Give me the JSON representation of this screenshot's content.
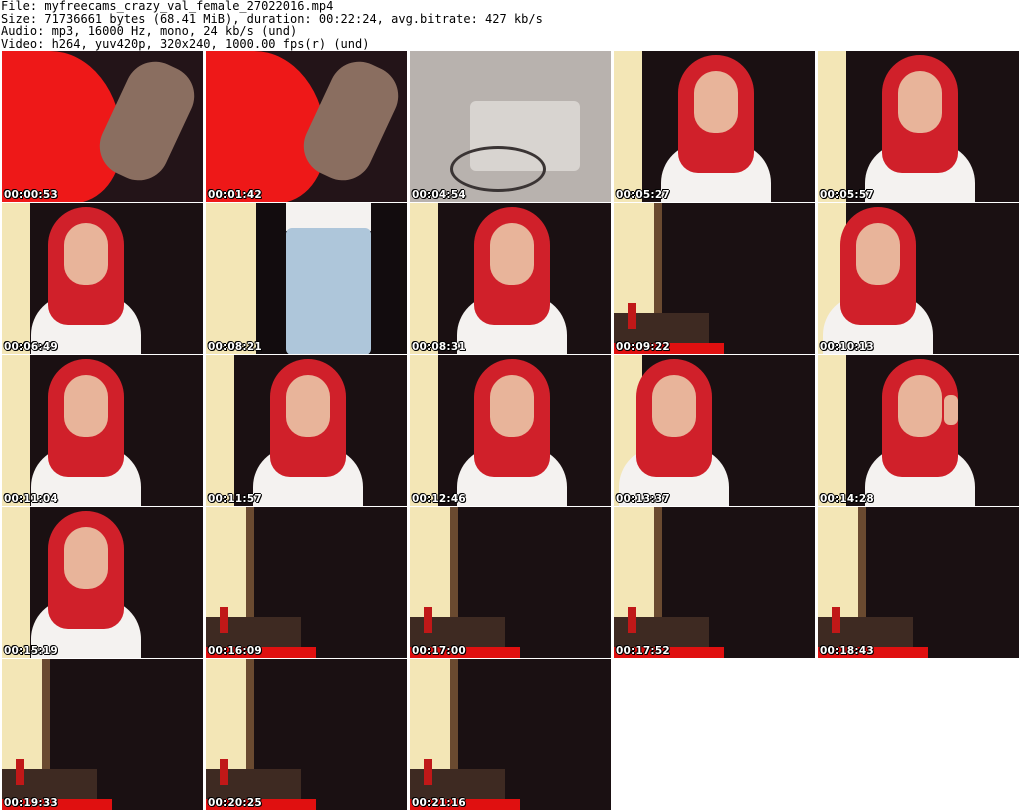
{
  "header": {
    "file": "File: myfreecams_crazy_val_female_27022016.mp4",
    "size": "Size: 71736661 bytes (68.41 MiB), duration: 00:22:24, avg.bitrate: 427 kb/s",
    "audio": "Audio: mp3, 16000 Hz, mono, 24 kb/s (und)",
    "video": "Video: h264, yuv420p, 320x240, 1000.00 fps(r) (und)"
  },
  "thumbnails": [
    {
      "time": "00:00:53",
      "scene": "red-closeup"
    },
    {
      "time": "00:01:42",
      "scene": "red-closeup"
    },
    {
      "time": "00:04:54",
      "scene": "grey-blur"
    },
    {
      "time": "00:05:27",
      "scene": "girl-center"
    },
    {
      "time": "00:05:57",
      "scene": "girl-center"
    },
    {
      "time": "00:06:49",
      "scene": "girl-left"
    },
    {
      "time": "00:08:21",
      "scene": "jeans"
    },
    {
      "time": "00:08:31",
      "scene": "girl-center"
    },
    {
      "time": "00:09:22",
      "scene": "empty-room"
    },
    {
      "time": "00:10:13",
      "scene": "girl-tilt"
    },
    {
      "time": "00:11:04",
      "scene": "girl-left"
    },
    {
      "time": "00:11:57",
      "scene": "girl-center"
    },
    {
      "time": "00:12:46",
      "scene": "girl-center"
    },
    {
      "time": "00:13:37",
      "scene": "girl-tilt"
    },
    {
      "time": "00:14:28",
      "scene": "girl-phone"
    },
    {
      "time": "00:15:19",
      "scene": "girl-left"
    },
    {
      "time": "00:16:09",
      "scene": "empty-room"
    },
    {
      "time": "00:17:00",
      "scene": "empty-room"
    },
    {
      "time": "00:17:52",
      "scene": "empty-room"
    },
    {
      "time": "00:18:43",
      "scene": "empty-room"
    },
    {
      "time": "00:19:33",
      "scene": "empty-room"
    },
    {
      "time": "00:20:25",
      "scene": "empty-room"
    },
    {
      "time": "00:21:16",
      "scene": "empty-room"
    }
  ],
  "colors": {
    "background": "#ffffff",
    "timestamp": "#ffffff",
    "curtain": "#1a1012",
    "wall": "#f3e6b6",
    "hair": "#d0202a",
    "shirt": "#f4f2f0",
    "skin": "#e8b49a",
    "red_fabric": "#ee1818"
  }
}
